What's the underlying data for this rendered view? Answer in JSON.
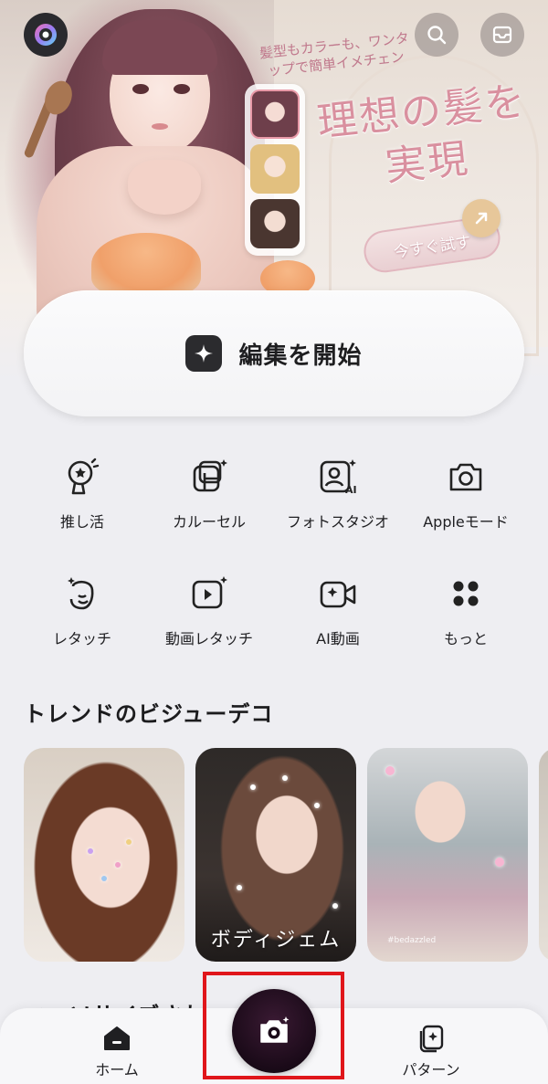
{
  "banner": {
    "subtitle": "髪型もカラーも、ワンタップで簡単イメチェン",
    "title": "理想の髪を実現",
    "cta": "今すぐ試す"
  },
  "top_bar": {
    "logo_icon": "app-logo-icon",
    "search_icon": "search-icon",
    "inbox_icon": "inbox-icon"
  },
  "edit": {
    "label": "編集を開始",
    "icon": "sparkle-icon"
  },
  "tools": [
    {
      "label": "推し活",
      "icon": "fan-icon"
    },
    {
      "label": "カルーセル",
      "icon": "carousel-icon"
    },
    {
      "label": "フォトスタジオ",
      "icon": "ai-portrait-icon"
    },
    {
      "label": "Appleモード",
      "icon": "camera-icon"
    },
    {
      "label": "レタッチ",
      "icon": "retouch-icon"
    },
    {
      "label": "動画レタッチ",
      "icon": "video-retouch-icon"
    },
    {
      "label": "AI動画",
      "icon": "ai-video-icon"
    },
    {
      "label": "もっと",
      "icon": "more-icon"
    }
  ],
  "trends": {
    "title": "トレンドのビジューデコ",
    "cards": [
      {
        "caption": ""
      },
      {
        "caption": "ボディジェム"
      },
      {
        "caption": "",
        "tag": "#bedazzled"
      }
    ]
  },
  "next_section_title": "ニーソサイズされ",
  "bottom_nav": {
    "home": "ホーム",
    "pattern": "パターン",
    "camera_icon": "camera-icon"
  },
  "colors": {
    "accent_pink": "#d9909f",
    "highlight_red": "#e0161b",
    "fab_dark": "#1a0a18"
  }
}
